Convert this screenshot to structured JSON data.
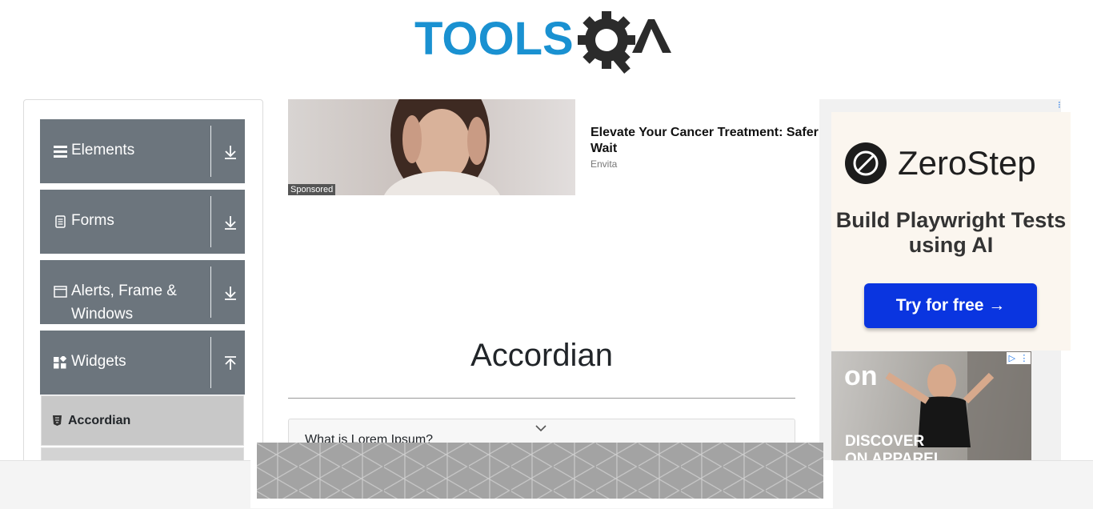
{
  "header": {
    "logo_text_primary": "TOOLS",
    "logo_text_secondary": "QA"
  },
  "sidebar": {
    "groups": [
      {
        "label": "Elements",
        "icon": "hamburger-icon",
        "toggle_icon": "chevron-down-arrow-icon"
      },
      {
        "label": "Forms",
        "icon": "document-icon",
        "toggle_icon": "chevron-down-arrow-icon"
      },
      {
        "label": "Alerts, Frame & Windows",
        "icon": "window-icon",
        "toggle_icon": "chevron-down-arrow-icon"
      },
      {
        "label": "Widgets",
        "icon": "widgets-icon",
        "toggle_icon": "chevron-up-arrow-icon"
      }
    ],
    "active_item": {
      "label": "Accordian",
      "icon": "html5-icon"
    }
  },
  "ad_banner": {
    "title": "Elevate Your Cancer Treatment: Safer Wait",
    "source": "Envita",
    "sponsored_label": "Sponsored"
  },
  "main": {
    "title": "Accordian",
    "accordion": [
      {
        "title": "What is Lorem Ipsum?"
      }
    ]
  },
  "right_ad": {
    "brand": "ZeroStep",
    "tagline": "Build Playwright Tests using AI",
    "cta": "Try for free →",
    "second_ad": {
      "logo": "on",
      "text_line1": "DISCOVER",
      "text_line2": "ON APPAREL"
    }
  },
  "colors": {
    "sidebar_group_bg": "#6c757d",
    "active_item_bg": "#c8c8c8",
    "cta_bg": "#0a35e0",
    "logo_blue": "#1a91d1"
  }
}
